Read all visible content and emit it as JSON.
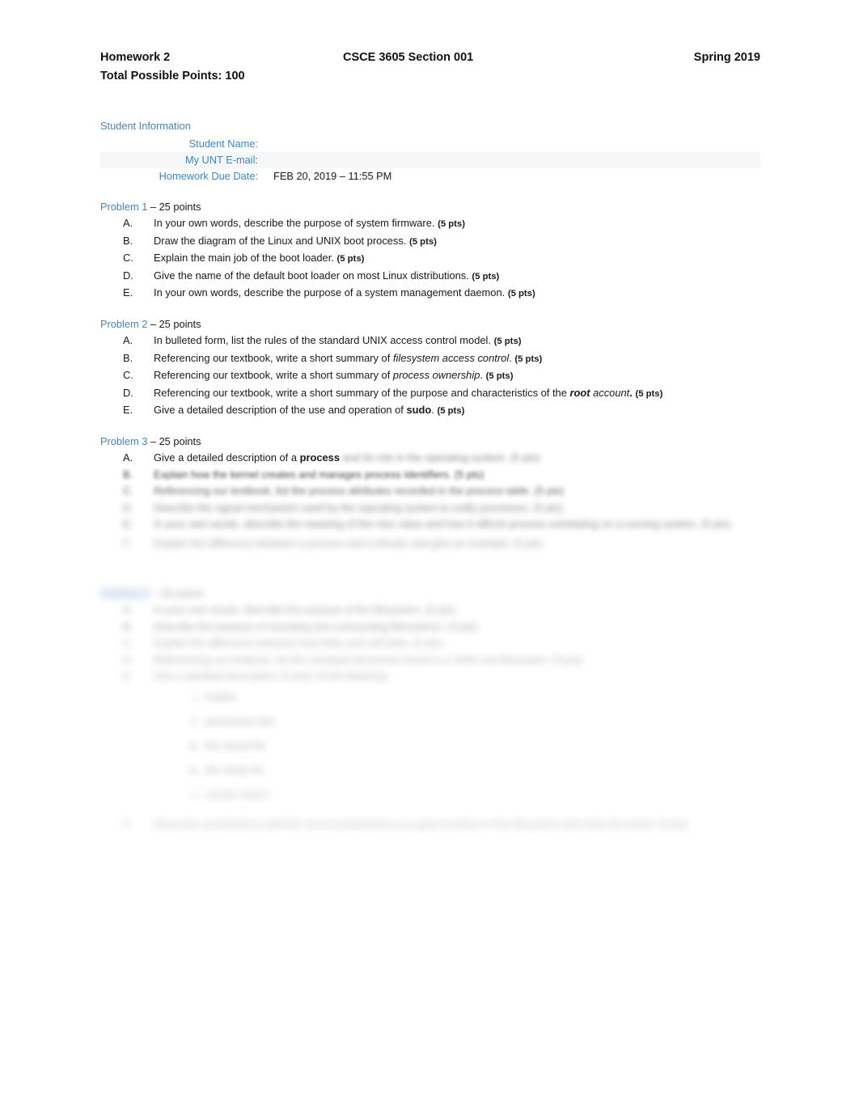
{
  "document": {
    "header": {
      "assignment": "Homework 2",
      "course": "CSCE 3605 Section 001",
      "term": "Spring 2019",
      "total_points": "Total Possible Points: 100"
    },
    "student_info": {
      "section_title": "Student Information",
      "rows": [
        {
          "label": "Student Name:",
          "value": ""
        },
        {
          "label": "My UNT E-mail:",
          "value": ""
        },
        {
          "label": "Homework Due Date:",
          "value": "FEB 20, 2019 – 11:55 PM"
        }
      ]
    },
    "problems": [
      {
        "number": "Problem 1",
        "points": "– 25 points",
        "items": [
          {
            "marker": "A.",
            "text": "In your own words, describe the purpose of system firmware.",
            "pts": "(5 pts)"
          },
          {
            "marker": "B.",
            "text": "Draw the diagram of the Linux and UNIX boot process.",
            "pts": "(5 pts)"
          },
          {
            "marker": "C.",
            "text": "Explain the main job of the boot loader.",
            "pts": "(5 pts)"
          },
          {
            "marker": "D.",
            "text": "Give the name of the default boot loader on most Linux distributions.",
            "pts": "(5 pts)"
          },
          {
            "marker": "E.",
            "text": "In your own words, describe the purpose of a system management daemon.",
            "pts": "(5 pts)"
          }
        ]
      },
      {
        "number": "Problem 2",
        "points": "– 25 points",
        "items": [
          {
            "marker": "A.",
            "pre": "In bulleted form, list the rules of the standard UNIX access control model.",
            "em": "",
            "post": "",
            "pts": "(5 pts)"
          },
          {
            "marker": "B.",
            "pre": "Referencing our textbook, write a short summary of ",
            "em": "filesystem access control",
            "post": ".",
            "pts": "(5 pts)"
          },
          {
            "marker": "C.",
            "pre": "Referencing our textbook, write a short summary of ",
            "em": "process ownership",
            "post": ".",
            "pts": "(5 pts)"
          },
          {
            "marker": "D.",
            "pre": "Referencing our textbook, write a short summary of the purpose and characteristics of the ",
            "em_bold": "root",
            "em": " account",
            "post": ".",
            "pts": "(5 pts)"
          },
          {
            "marker": "E.",
            "pre": "Give a detailed description of the use and operation of ",
            "strong": "sudo",
            "post": ".",
            "pts": "(5 pts)"
          }
        ]
      },
      {
        "number": "Problem 3",
        "points": "– 25 points",
        "item_a": {
          "marker": "A.",
          "pre": "Give a detailed description of a ",
          "strong": "process",
          "trailing_illegible": "and its role in the operating system. (5 pts)"
        },
        "illegible_items": [
          {
            "marker": "B.",
            "text": "Explain how the kernel creates and manages process identifiers. (5 pts)"
          },
          {
            "marker": "C.",
            "text": "Referencing our textbook, list the process attributes recorded in the process table. (5 pts)"
          },
          {
            "marker": "D.",
            "text": "Describe the signal mechanism used by the operating system to notify processes. (5 pts)"
          },
          {
            "marker": "E.",
            "text": "In your own words, describe the meaning of the nice value and how it affects process scheduling on a running system. (5 pts)"
          },
          {
            "marker": "F.",
            "text": "Explain the difference between a process and a thread, and give an example. (5 pts)"
          }
        ]
      },
      {
        "number": "Problem 4",
        "points": "– 25 points",
        "highlighted": true,
        "illegible_items": [
          {
            "marker": "A.",
            "text": "In your own words, describe the purpose of the filesystem. (5 pts)"
          },
          {
            "marker": "B.",
            "text": "Describe the purpose of mounting and unmounting filesystems. (5 pts)"
          },
          {
            "marker": "C.",
            "text": "Explain the difference between hard links and soft links. (5 pts)"
          },
          {
            "marker": "D.",
            "text": "Referencing our textbook, list the standard directories found in a UNIX root filesystem. (5 pts)"
          },
          {
            "marker": "E.",
            "text": "Give a detailed description of each of the following:",
            "sub_items": [
              {
                "marker": "i.",
                "text": "inodes"
              },
              {
                "marker": "ii.",
                "text": "permission bits"
              },
              {
                "marker": "iii.",
                "text": "the setuid bit"
              },
              {
                "marker": "iv.",
                "text": "the sticky bit"
              },
              {
                "marker": "v.",
                "text": "umask values"
              }
            ]
          },
          {
            "marker": "F.",
            "text": "Show the commands to add the correct permissions to a given location in the filesystem and verify the result. (5 pts)"
          }
        ]
      }
    ]
  },
  "colors": {
    "heading_blue": "#4a84b8",
    "label_blue": "#3e85c6",
    "highlight_blue": "#d3e3f3",
    "shaded_row": "#f5f6f7",
    "body_text": "#1a1a1a",
    "page_background": "#ffffff"
  }
}
